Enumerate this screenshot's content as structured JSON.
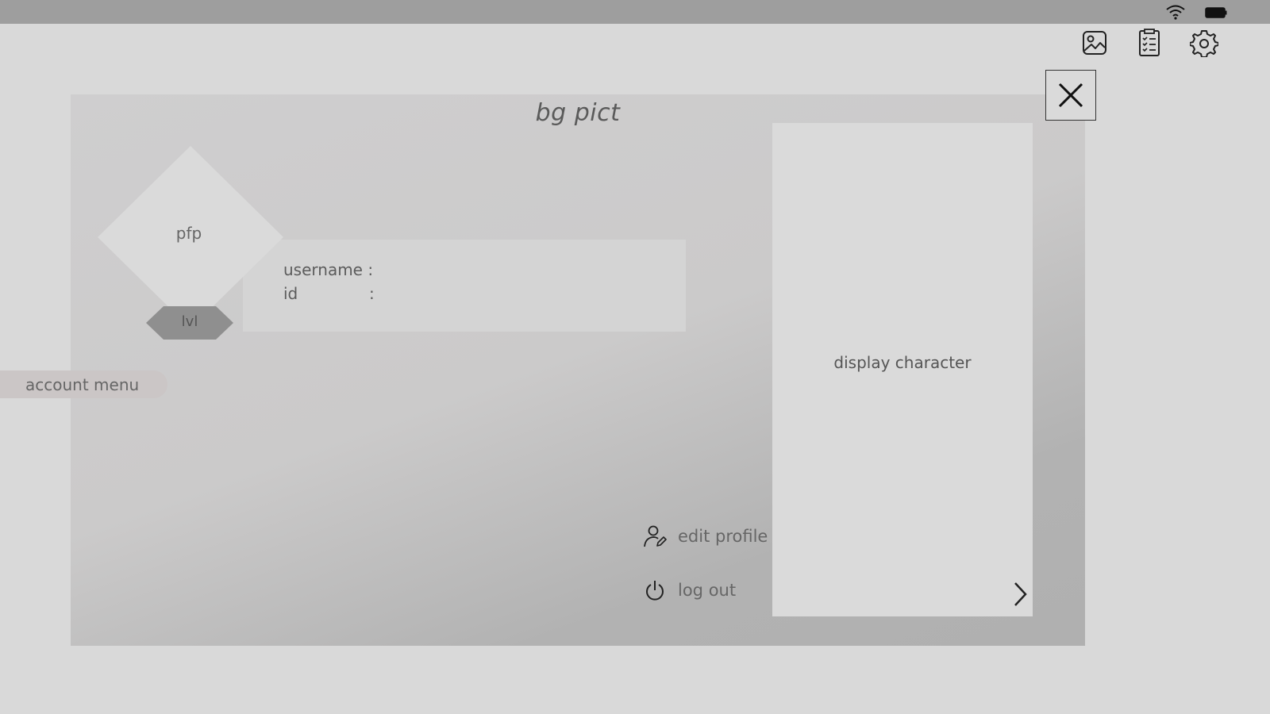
{
  "topbar": {
    "icons": [
      "gallery-icon",
      "checklist-icon",
      "settings-icon"
    ]
  },
  "panel": {
    "background_label": "bg pict",
    "profile": {
      "pfp_label": "pfp",
      "level_label": "lvl",
      "username_label": "username :",
      "id_label": "id",
      "id_colon": ":"
    },
    "account_menu_label": "account menu",
    "character": {
      "label": "display character"
    },
    "actions": {
      "edit_profile_label": "edit profile",
      "log_out_label": "log out"
    }
  },
  "colors": {
    "statusbar": "#9e9e9e",
    "background": "#d9d9d9",
    "level_badge": "#8f8f8f",
    "account_menu": "#cbc6c6"
  }
}
